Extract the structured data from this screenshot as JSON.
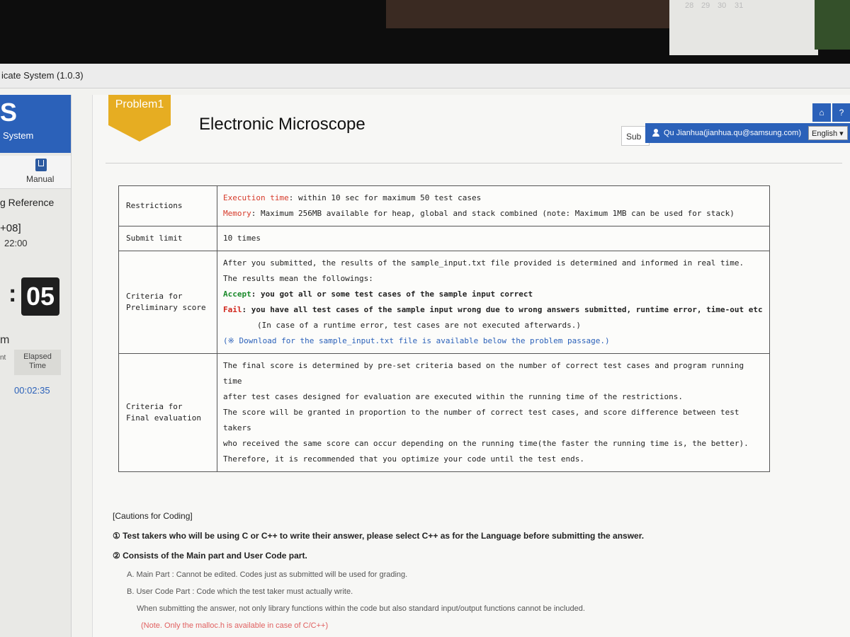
{
  "window": {
    "title": "icate System (1.0.3)"
  },
  "calendar": {
    "days": [
      "28",
      "29",
      "30",
      "31"
    ]
  },
  "sidebar": {
    "brand_letter": "S",
    "brand_sub": "System",
    "manual_label": "Manual",
    "reference_label": "g Reference",
    "timezone": "+08]",
    "timezone_time": "22:00",
    "timer_digits": "05",
    "timer_colon": ":",
    "remaining_label": "m",
    "tab_left": "nt",
    "tab_elapsed": "Elapsed Time",
    "elapsed_value": "00:02:35"
  },
  "header": {
    "problem_badge": "Problem1",
    "problem_title": "Electronic Microscope",
    "submit_partial": "Sub",
    "user": "Qu Jianhua(jianhua.qu@samsung.com)",
    "language": "English ▾",
    "home_icon": "⌂",
    "help_icon": "?"
  },
  "restrictions": {
    "label": "Restrictions",
    "exec_key": "Execution time",
    "exec_text": ": within 10 sec for maximum 50 test cases",
    "mem_key": "Memory",
    "mem_text": ": Maximum 256MB available for heap, global and stack combined (note: Maximum 1MB can be used for stack)"
  },
  "submit_limit": {
    "label": "Submit limit",
    "value": "10 times"
  },
  "preliminary": {
    "label": "Criteria for Preliminary score",
    "line1": "After you submitted, the results of the sample_input.txt file provided is determined and informed in real time.",
    "line2": "The results mean the followings:",
    "accept_key": "Accept",
    "accept_text": ": you got all or some test cases of the sample input correct",
    "fail_key": "Fail",
    "fail_text": ": you have all test cases of the sample input wrong due to wrong answers submitted, runtime error, time-out etc",
    "runtime_note": "(In case of a runtime error, test cases are not executed afterwards.)",
    "download_note": "(※ Download for the sample_input.txt file is available below the problem passage.)"
  },
  "final": {
    "label": "Criteria for Final evaluation",
    "line1": "The final score is determined by pre-set criteria based on the number of correct test cases and program running time",
    "line2": "after test cases designed for evaluation are executed within the running time of the restrictions.",
    "line3": "The score will be granted in proportion to the number of correct test cases, and score difference between test takers",
    "line4": "who received the same score can occur depending on the running time(the faster the running time is, the better).",
    "line5": "Therefore, it is recommended that you optimize your code until the test ends."
  },
  "cautions": {
    "heading": "[Cautions for Coding]",
    "item1": "① Test takers who will be using C or C++ to write their answer, please select C++ as for the Language before submitting the answer.",
    "item2": "② Consists of the Main part and User Code part.",
    "subA": "A. Main Part : Cannot be edited. Codes just as submitted will be used for grading.",
    "subB": "B. User Code Part : Code which the test taker must actually write.",
    "subB2": "When submitting the answer, not only library functions within the code but also standard input/output functions cannot be included.",
    "note": "(Note. Only the malloc.h is available in case of C/C++)"
  }
}
